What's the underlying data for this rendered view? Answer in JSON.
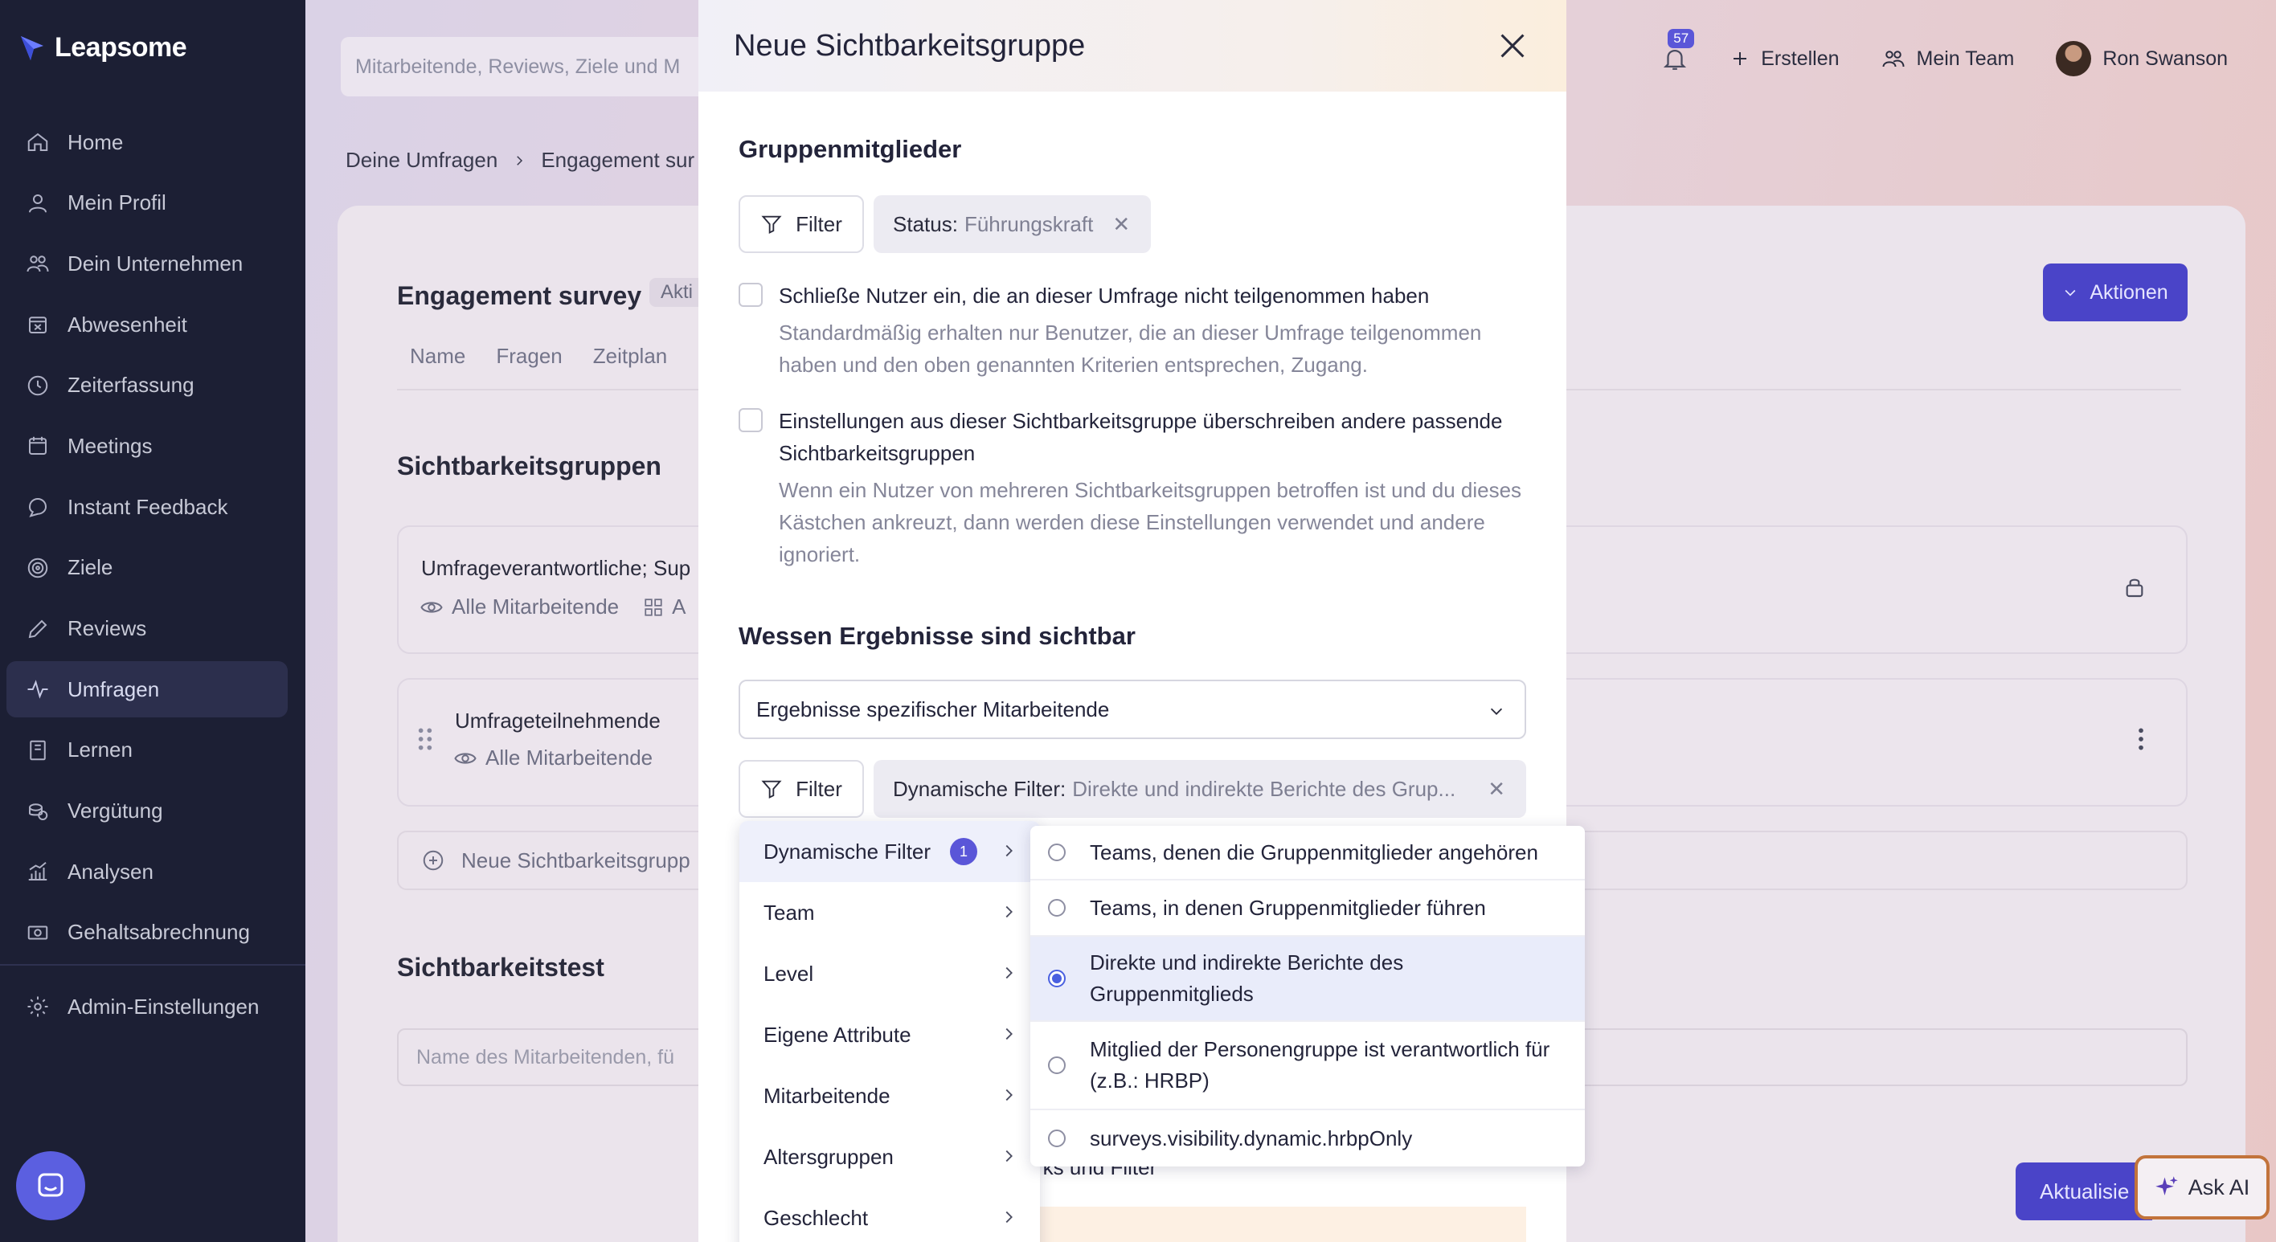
{
  "app": {
    "logo_text": "Leapsome"
  },
  "sidebar": {
    "items": [
      {
        "label": "Home",
        "icon": "home-icon"
      },
      {
        "label": "Mein Profil",
        "icon": "user-icon"
      },
      {
        "label": "Dein Unternehmen",
        "icon": "people-icon"
      },
      {
        "label": "Abwesenheit",
        "icon": "calendar-x-icon"
      },
      {
        "label": "Zeiterfassung",
        "icon": "clock-icon"
      },
      {
        "label": "Meetings",
        "icon": "calendar-icon"
      },
      {
        "label": "Instant Feedback",
        "icon": "chat-icon"
      },
      {
        "label": "Ziele",
        "icon": "target-icon"
      },
      {
        "label": "Reviews",
        "icon": "pencil-icon"
      },
      {
        "label": "Umfragen",
        "icon": "pulse-icon",
        "active": true
      },
      {
        "label": "Lernen",
        "icon": "book-icon"
      },
      {
        "label": "Vergütung",
        "icon": "coins-icon"
      },
      {
        "label": "Analysen",
        "icon": "chart-icon"
      },
      {
        "label": "Gehaltsabrechnung",
        "icon": "money-icon"
      }
    ],
    "admin_label": "Admin-Einstellungen"
  },
  "topbar": {
    "search_placeholder": "Mitarbeitende, Reviews, Ziele und M",
    "notification_count": "57",
    "create_label": "Erstellen",
    "team_label": "Mein Team",
    "user_name": "Ron Swanson"
  },
  "breadcrumb": {
    "first": "Deine Umfragen",
    "second": "Engagement sur"
  },
  "survey": {
    "title": "Engagement survey",
    "status_badge": "Akti",
    "tabs": [
      "Name",
      "Fragen",
      "Zeitplan"
    ],
    "actions_label": "Aktionen"
  },
  "visibility_section": {
    "title": "Sichtbarkeitsgruppen",
    "groups": [
      {
        "name": "Umfrageverantwortliche; Sup",
        "meta": "Alle Mitarbeitende",
        "meta2": "A"
      },
      {
        "name": "Umfrageteilnehmende",
        "meta": "Alle Mitarbeitende",
        "meta2": ""
      }
    ],
    "new_group_label": "Neue Sichtbarkeitsgrupp"
  },
  "visibility_test": {
    "title": "Sichtbarkeitstest",
    "placeholder": "Name des Mitarbeitenden, fü"
  },
  "footer": {
    "update_label": "Aktualisie",
    "ask_ai_label": "Ask AI"
  },
  "modal": {
    "title": "Neue Sichtbarkeitsgruppe",
    "members_title": "Gruppenmitglieder",
    "filter_label": "Filter",
    "status_chip": {
      "key": "Status:",
      "value": "Führungskraft"
    },
    "checkbox1": {
      "label": "Schließe Nutzer ein, die an dieser Umfrage nicht teilgenommen haben",
      "help": "Standardmäßig erhalten nur Benutzer, die an dieser Umfrage teilgenommen haben und den oben genannten Kriterien entsprechen, Zugang."
    },
    "checkbox2": {
      "label": "Einstellungen aus dieser Sichtbarkeitsgruppe überschreiben andere passende Sichtbarkeitsgruppen",
      "help": "Wenn ein Nutzer von mehreren Sichtbarkeitsgruppen betroffen ist und du dieses Kästchen ankreuzt, dann werden diese Einstellungen verwendet und andere ignoriert."
    },
    "results_title": "Wessen Ergebnisse sind sichtbar",
    "results_select": "Ergebnisse spezifischer Mitarbeitende",
    "dynamic_chip": {
      "key": "Dynamische Filter:",
      "value": "Direkte und indirekte Berichte des Grup..."
    },
    "behind_text": "rks und Filter"
  },
  "filter_menu": {
    "items": [
      {
        "label": "Dynamische Filter",
        "badge": "1"
      },
      {
        "label": "Team"
      },
      {
        "label": "Level"
      },
      {
        "label": "Eigene Attribute"
      },
      {
        "label": "Mitarbeitende"
      },
      {
        "label": "Altersgruppen"
      },
      {
        "label": "Geschlecht"
      }
    ]
  },
  "dynamic_options": [
    {
      "label": "Teams, denen die Gruppenmitglieder angehören",
      "selected": false
    },
    {
      "label": "Teams, in denen Gruppenmitglieder führen",
      "selected": false
    },
    {
      "label": "Direkte und indirekte Berichte des Gruppenmitglieds",
      "selected": true
    },
    {
      "label": "Mitglied der Personengruppe ist verantwortlich für (z.B.: HRBP)",
      "selected": false
    },
    {
      "label": "surveys.visibility.dynamic.hrbpOnly",
      "selected": false
    }
  ],
  "colors": {
    "accent": "#4a44c8",
    "sidebar": "#1c1f34",
    "selected_row": "#e9ecfa"
  }
}
